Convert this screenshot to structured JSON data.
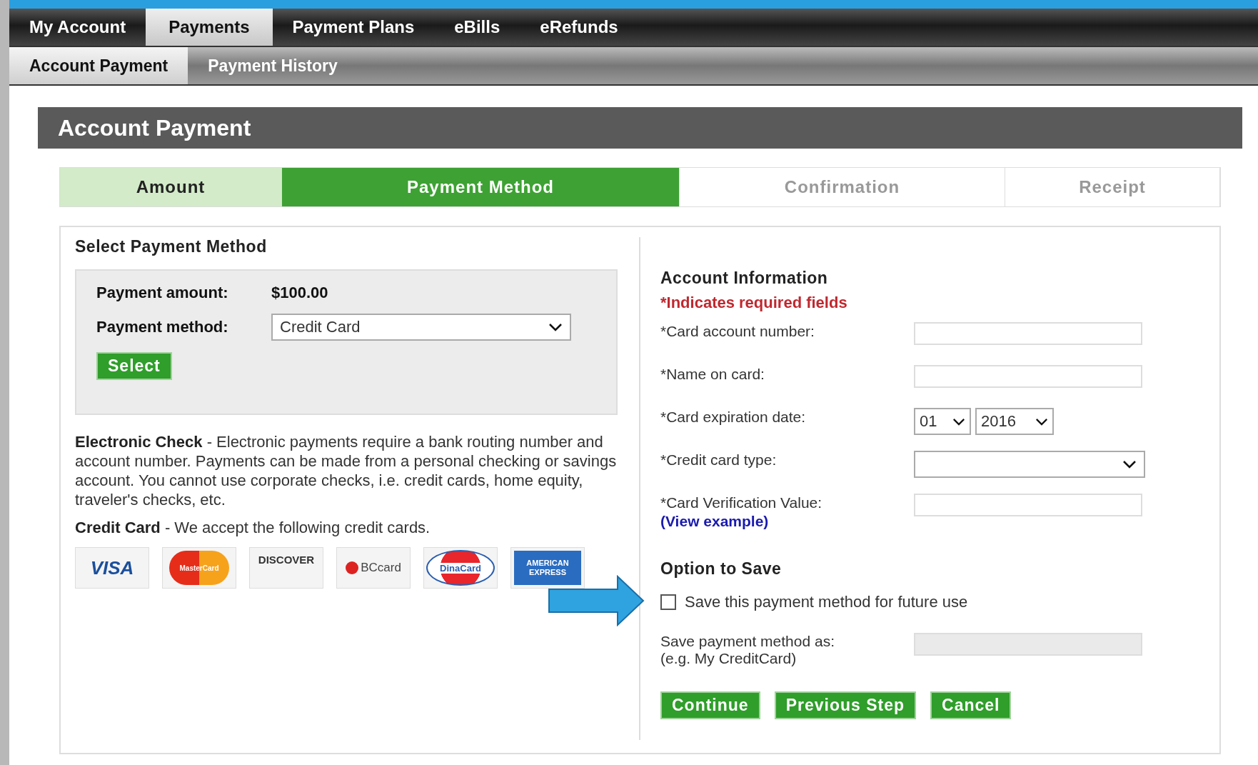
{
  "nav": {
    "tabs": [
      {
        "label": "My Account",
        "selected": false
      },
      {
        "label": "Payments",
        "selected": true
      },
      {
        "label": "Payment Plans",
        "selected": false
      },
      {
        "label": "eBills",
        "selected": false
      },
      {
        "label": "eRefunds",
        "selected": false
      }
    ],
    "subtabs": [
      {
        "label": "Account Payment",
        "selected": true
      },
      {
        "label": "Payment History",
        "selected": false
      }
    ]
  },
  "page_title": "Account Payment",
  "steps": [
    {
      "label": "Amount",
      "selected": false,
      "completed": true
    },
    {
      "label": "Payment Method",
      "selected": true,
      "completed": false
    },
    {
      "label": "Confirmation",
      "selected": false,
      "completed": false
    },
    {
      "label": "Receipt",
      "selected": false,
      "completed": false
    }
  ],
  "select_section": {
    "title": "Select Payment Method",
    "amount_label": "Payment amount:",
    "amount_value": "$100.00",
    "method_label": "Payment method:",
    "method_value": "Credit Card",
    "select_button": "Select"
  },
  "info": [
    {
      "term": "Electronic Check",
      "text": " - Electronic payments require a bank routing number and account number. Payments can be made from a personal checking or savings account. You cannot use corporate checks, i.e. credit cards, home equity, traveler's checks, etc."
    },
    {
      "term": "Credit Card",
      "text": " - We accept the following credit cards."
    }
  ],
  "cards": [
    {
      "kind": "visa",
      "label": "VISA"
    },
    {
      "kind": "mastercard",
      "label": "MasterCard"
    },
    {
      "kind": "discover",
      "label": "DISCOVER"
    },
    {
      "kind": "bccard",
      "label": "BCcard"
    },
    {
      "kind": "dinacard",
      "label": "DinaCard"
    },
    {
      "kind": "amex",
      "label": "AMERICAN EXPRESS"
    }
  ],
  "account_info": {
    "title": "Account Information",
    "required_note": "*Indicates required fields",
    "fields": [
      {
        "kind": "text",
        "label": "*Card account number:"
      },
      {
        "kind": "text",
        "label": "*Name on card:"
      },
      {
        "kind": "expiry",
        "label": "*Card expiration date:",
        "month": "01",
        "year": "2016"
      },
      {
        "kind": "select",
        "label": "*Credit card type:"
      },
      {
        "kind": "cvv",
        "label": "*Card Verification Value:",
        "link": "(View example)"
      }
    ]
  },
  "save_option": {
    "title": "Option to Save",
    "checkbox_label": "Save this payment method for future use",
    "checked": false,
    "save_as_label": "Save payment method as:",
    "save_as_hint": "(e.g. My CreditCard)",
    "save_as_disabled": true
  },
  "buttons": [
    "Continue",
    "Previous Step",
    "Cancel"
  ]
}
